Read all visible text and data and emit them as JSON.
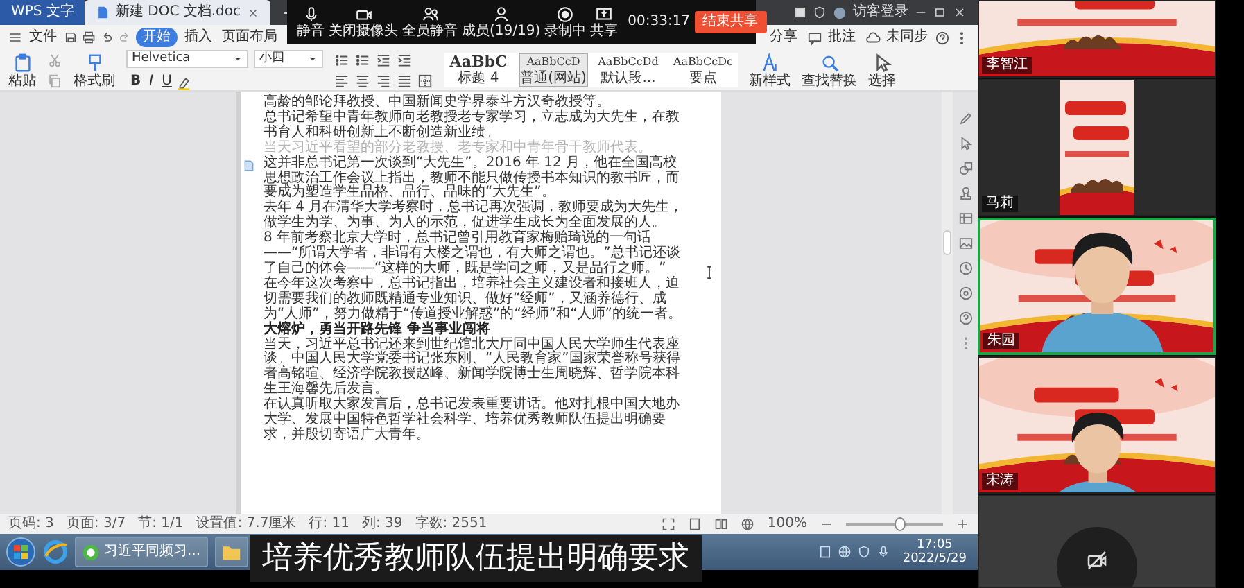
{
  "app_tabs": [
    {
      "label": "WPS 文字",
      "selected": false
    },
    {
      "label": "新建 DOC 文档.doc",
      "selected": true
    }
  ],
  "account": "访客登录",
  "menu": [
    {
      "label": "文件",
      "selected": false
    },
    {
      "label": "开始",
      "selected": true
    },
    {
      "label": "插入",
      "selected": false
    },
    {
      "label": "页面布局",
      "selected": false
    }
  ],
  "menu_right": [
    "分享",
    "批注",
    "未同步"
  ],
  "meeting_toolbar": {
    "buttons": [
      {
        "kind": "mic",
        "label": "静音"
      },
      {
        "kind": "camera",
        "label": "关闭摄像头"
      },
      {
        "kind": "mute-all",
        "label": "全员静音"
      },
      {
        "kind": "members",
        "label": "成员(19/19)"
      },
      {
        "kind": "record",
        "label": "录制中"
      },
      {
        "kind": "share",
        "label": "共享"
      }
    ],
    "timer": "00:33:17",
    "end_button": "结束共享"
  },
  "ribbon": {
    "paste": "粘贴",
    "format_painter": "格式刷",
    "font": "Helvetica",
    "size": "小四",
    "format_buttons": [
      "B",
      "I",
      "U"
    ],
    "styles": [
      {
        "sample": "AaBbC",
        "label": "标题 4",
        "selected": false
      },
      {
        "sample": "AaBbCcD",
        "label": "普通(网站)",
        "selected": true
      },
      {
        "sample": "AaBbCcDd",
        "label": "默认段...",
        "selected": false
      },
      {
        "sample": "AaBbCcDc",
        "label": "要点",
        "selected": false
      }
    ],
    "new_style": "新样式",
    "find_replace": "查找替换",
    "select": "选择"
  },
  "document": {
    "paragraphs": [
      {
        "kind": "body",
        "text": "高龄的邹论拜教授、中国新闻史学界泰斗方汉奇教授等。"
      },
      {
        "kind": "body",
        "text": "总书记希望中青年教师向老教授老专家学习，立志成为大先生，在教书育人和科研创新上不断创造新业绩。"
      },
      {
        "kind": "caption",
        "text": "当天习近平看望的部分老教授、老专家和中青年骨干教师代表。"
      },
      {
        "kind": "body",
        "text": "这并非总书记第一次谈到“大先生”。2016 年 12 月，他在全国高校思想政治工作会议上指出，教师不能只做传授书本知识的教书匠，而要成为塑造学生品格、品行、品味的“大先生”。"
      },
      {
        "kind": "body",
        "text": "去年 4 月在清华大学考察时，总书记再次强调，教师要成为大先生，做学生为学、为事、为人的示范，促进学生成长为全面发展的人。"
      },
      {
        "kind": "body",
        "text": "8 年前考察北京大学时，总书记曾引用教育家梅贻琦说的一句话——“所谓大学者，非谓有大楼之谓也，有大师之谓也。”总书记还谈了自己的体会——“这样的大师，既是学问之师，又是品行之师。”"
      },
      {
        "kind": "body",
        "text": "在今年这次考察中，总书记指出，培养社会主义建设者和接班人，迫切需要我们的教师既精通专业知识、做好“经师”，又涵养德行、成为“人师”，努力做精于“传道授业解惑”的“经师”和“人师”的统一者。"
      },
      {
        "kind": "heading",
        "text": "大熔炉，勇当开路先锋 争当事业闯将"
      },
      {
        "kind": "body",
        "text": "当天，习近平总书记还来到世纪馆北大厅同中国人民大学师生代表座谈。中国人民大学党委书记张东刚、“人民教育家”国家荣誉称号获得者高铭暄、经济学院教授赵峰、新闻学院博士生周晓辉、哲学院本科生王海馨先后发言。"
      },
      {
        "kind": "body",
        "text": "在认真听取大家发言后，总书记发表重要讲话。他对扎根中国大地办大学、发展中国特色哲学社会科学、培养优秀教师队伍提出明确要求，并殷切寄语广大青年。"
      }
    ]
  },
  "status_bar": [
    "页码: 3",
    "页面: 3/7",
    "节: 1/1",
    "设置值: 7.7厘米",
    "行: 11",
    "列: 39",
    "字数: 2551"
  ],
  "zoom": "100%",
  "zoom_slider": {
    "level": 0.55
  },
  "taskbar": {
    "windows": [
      {
        "label": "习近平同频习...",
        "selected": false
      }
    ],
    "time": "17:05",
    "date": "2022/5/29"
  },
  "subtitle": "培养优秀教师队伍提出明确要求",
  "participants": [
    {
      "name": "李智江",
      "kind": "banner",
      "speaking": false
    },
    {
      "name": "马莉",
      "kind": "portrait",
      "speaking": false
    },
    {
      "name": "朱园",
      "kind": "person",
      "speaking": true
    },
    {
      "name": "宋涛",
      "kind": "person-low",
      "speaking": false
    },
    {
      "kind": "off",
      "speaking": false
    }
  ]
}
